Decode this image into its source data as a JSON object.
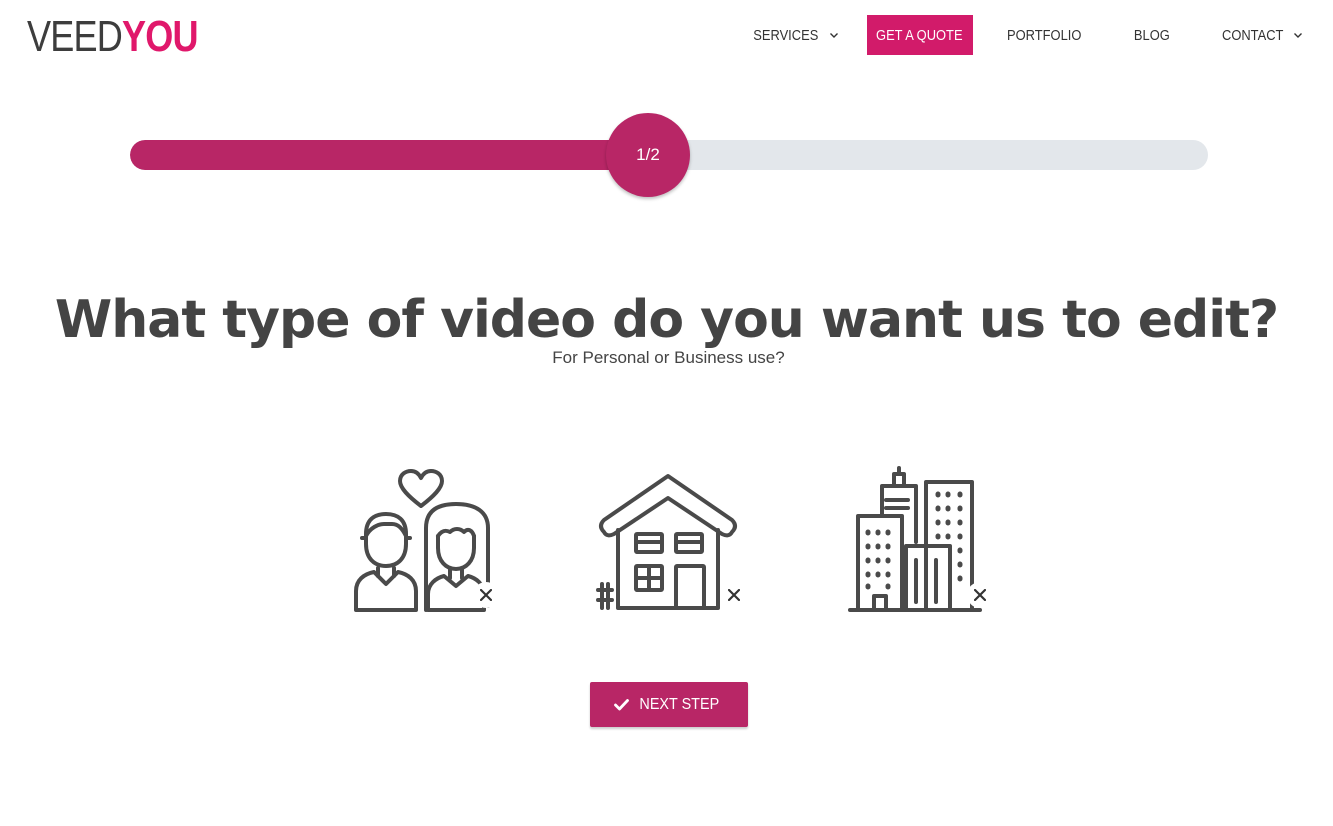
{
  "brand": {
    "logo_part1": "VEED",
    "logo_part2": "YOU",
    "accent": "#b82666",
    "logo_accent": "#e0186b"
  },
  "nav": {
    "services": "SERVICES",
    "quote": "GET A QUOTE",
    "portfolio": "PORTFOLIO",
    "blog": "BLOG",
    "contact": "CONTACT"
  },
  "progress": {
    "label": "1/2",
    "fraction": 0.5
  },
  "question": {
    "title": "What type of video do you want us to edit?",
    "subtitle": "For Personal or Business use?"
  },
  "options": [
    {
      "icon": "couple-heart-icon",
      "selected": false
    },
    {
      "icon": "house-icon",
      "selected": false
    },
    {
      "icon": "office-buildings-icon",
      "selected": false
    }
  ],
  "next_button": {
    "label": "NEXT STEP",
    "icon": "check-icon"
  }
}
